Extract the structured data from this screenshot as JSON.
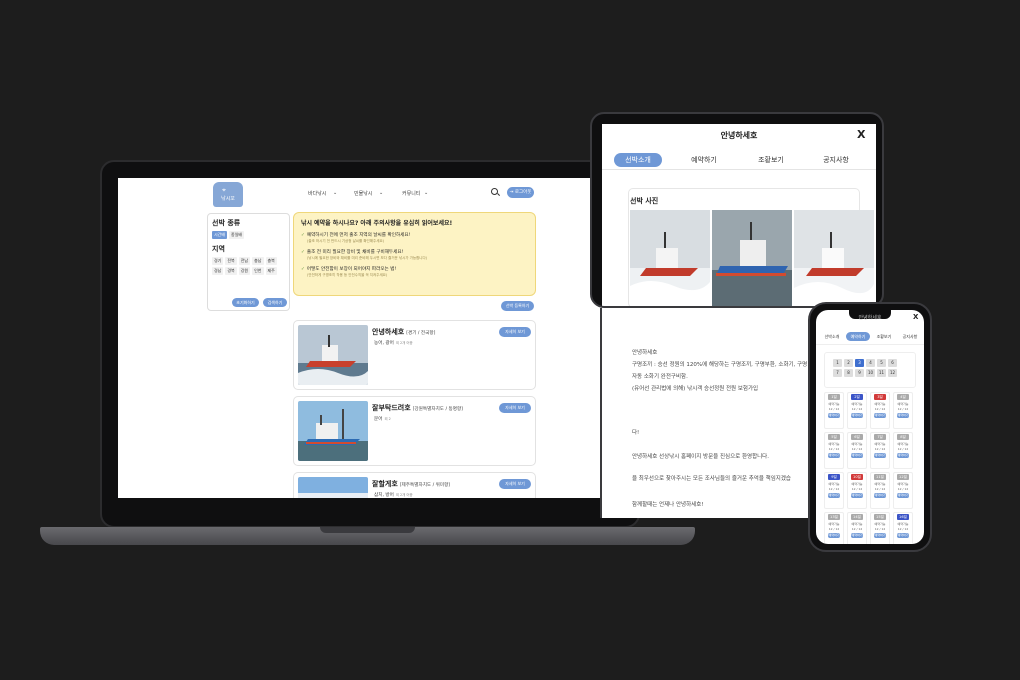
{
  "laptop": {
    "logo_text": "낚시꼬",
    "nav": [
      "바다낚시",
      "민물낚시",
      "커뮤니티"
    ],
    "login_label": "로그아웃",
    "filter": {
      "ship_type_title": "선박 종류",
      "ship_types": [
        "시간배",
        "종일배"
      ],
      "region_title": "지역",
      "regions": [
        "경기",
        "전북",
        "전남",
        "충남",
        "충북",
        "경남",
        "경북",
        "강원",
        "인천",
        "제주"
      ],
      "reset_label": "초기화하기",
      "search_label": "검색하기"
    },
    "notice": {
      "title": "낚시 예약을 하시나요? 아래 주의사항을 유심히 읽어보세요!",
      "items": [
        {
          "text": "예약하시기 전에 먼저 출조 지역의 날씨를 확인하세요!",
          "sub": "(출조 하시기 전 반드시 기상청 날씨를 확인해주세요)"
        },
        {
          "text": "출조 전 미리 필요한 장비 및 채비를 구비해두세요!",
          "sub": "(낚시에 필요한 장비와 채비를 미리 준비해 두시면 보다 즐거운 낚시가 가능합니다)"
        },
        {
          "text": "어떻도 안전함이 보장이 되어야지 파라오는 법!",
          "sub": "(안전하게 구명조끼 착용 등 안전수칙을 꼭 지켜주세요)"
        }
      ]
    },
    "register_label": "선박 등록하기",
    "ships": [
      {
        "name": "안녕하세호",
        "region": "[경기 / 전국항]",
        "fish": "농어, 광어",
        "fish_note": "외 2개 어종",
        "button": "자세히 보기"
      },
      {
        "name": "잘부탁드려호",
        "region": "[강원특별자치도 / 동명항]",
        "fish": "문어",
        "fish_note": "외 2",
        "button": "자세히 보기"
      },
      {
        "name": "잘할게호",
        "region": "[제주특별자치도 / 위미항]",
        "fish": "삼치, 방어",
        "fish_note": "외 2개 어종",
        "button": "자세히 보기"
      }
    ]
  },
  "tablet": {
    "title": "안녕하세호",
    "tabs": [
      "선박소개",
      "예약하기",
      "조황보기",
      "공지사항"
    ],
    "section_title": "선박 사진",
    "lines": [
      "안녕하세호",
      "구명조끼 : 승선 정원의 120%에 해당하는 구명조끼, 구명부환, 소화기, 구명",
      "자동 소화기 완전구비함.",
      "(유어선 관리법에 의해) 낚시객 승선정원 전원 보험가입",
      "",
      "",
      "안녕하세호 선상낚시 홈페이지 방문을 진심으로 환영합니다.",
      "을 최우선으로 찾아주시는 모든 조사님들의 즐거운 추억을 책임지겠습",
      "",
      "함께할때는 언제나 안녕하세호!"
    ],
    "line_fragments": [
      "다!"
    ]
  },
  "phone": {
    "title": "안녕하세호",
    "tabs": [
      "선박소개",
      "예약하기",
      "조황보기",
      "공지사항"
    ],
    "months": [
      "1",
      "2",
      "3",
      "4",
      "5",
      "6",
      "7",
      "8",
      "9",
      "10",
      "11",
      "12"
    ],
    "selected_month": "3",
    "days": [
      {
        "label": "1일",
        "status": "예약가능",
        "seats": "12 / 12",
        "button": "예약하기",
        "color": "gray"
      },
      {
        "label": "2일",
        "status": "예약가능",
        "seats": "12 / 12",
        "button": "예약하기",
        "color": "blue"
      },
      {
        "label": "3일",
        "status": "예약가능",
        "seats": "12 / 12",
        "button": "예약하기",
        "color": "red"
      },
      {
        "label": "4일",
        "status": "예약가능",
        "seats": "12 / 12",
        "button": "예약하기",
        "color": "gray"
      },
      {
        "label": "5일",
        "status": "예약가능",
        "seats": "12 / 12",
        "button": "예약하기",
        "color": "gray"
      },
      {
        "label": "6일",
        "status": "예약가능",
        "seats": "12 / 12",
        "button": "예약하기",
        "color": "gray"
      },
      {
        "label": "7일",
        "status": "예약가능",
        "seats": "12 / 12",
        "button": "예약하기",
        "color": "gray"
      },
      {
        "label": "8일",
        "status": "예약가능",
        "seats": "12 / 12",
        "button": "예약하기",
        "color": "gray"
      },
      {
        "label": "9일",
        "status": "예약가능",
        "seats": "12 / 12",
        "button": "예약하기",
        "color": "blue"
      },
      {
        "label": "10일",
        "status": "예약가능",
        "seats": "12 / 12",
        "button": "예약하기",
        "color": "red"
      },
      {
        "label": "11일",
        "status": "예약가능",
        "seats": "12 / 12",
        "button": "예약하기",
        "color": "gray"
      },
      {
        "label": "12일",
        "status": "예약가능",
        "seats": "12 / 12",
        "button": "예약하기",
        "color": "gray"
      },
      {
        "label": "13일",
        "status": "예약가능",
        "seats": "12 / 12",
        "button": "예약하기",
        "color": "gray"
      },
      {
        "label": "14일",
        "status": "예약가능",
        "seats": "12 / 12",
        "button": "예약하기",
        "color": "gray"
      },
      {
        "label": "15일",
        "status": "예약가능",
        "seats": "12 / 12",
        "button": "예약하기",
        "color": "gray"
      },
      {
        "label": "16일",
        "status": "예약가능",
        "seats": "12 / 12",
        "button": "예약하기",
        "color": "blue"
      }
    ]
  },
  "colors": {
    "accent": "#6f98d6",
    "notice_bg": "#fdf3c4",
    "saturday": "#3b54c7",
    "sunday": "#d23a3a",
    "background": "#1d1d1d"
  }
}
